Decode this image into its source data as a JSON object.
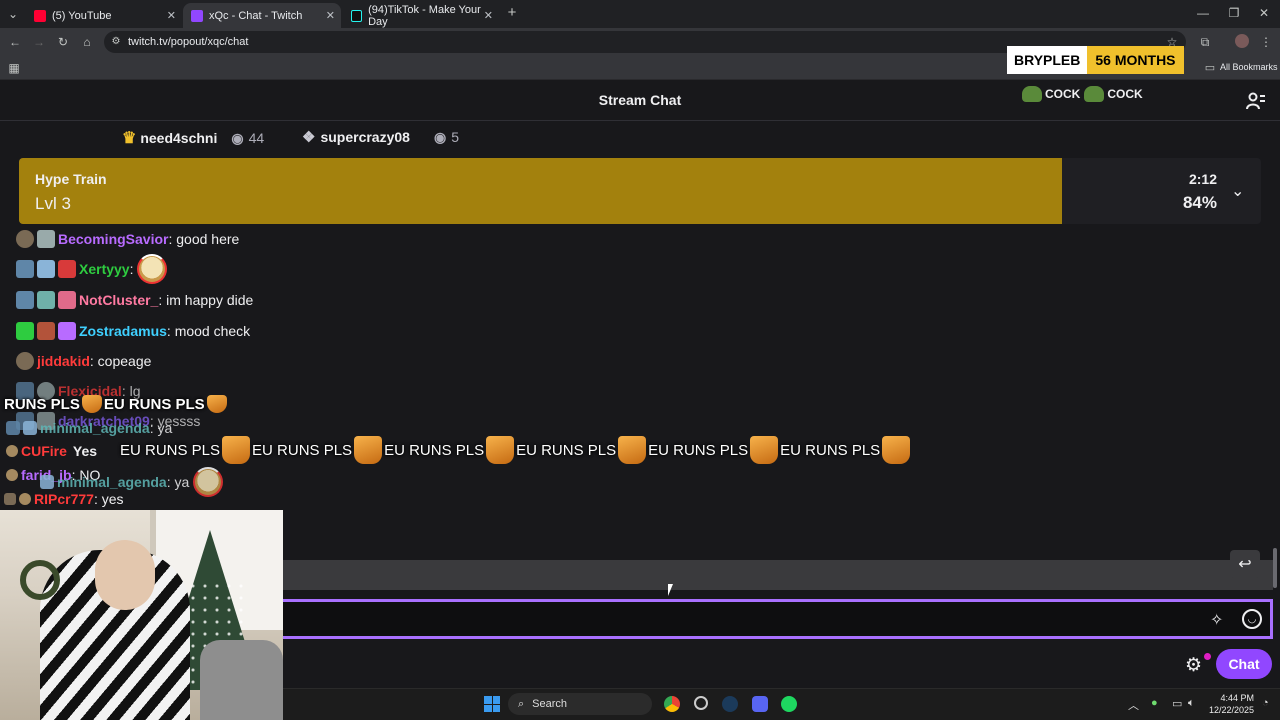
{
  "browser": {
    "tabs": [
      {
        "label": "(5) YouTube",
        "color": "#ff0033"
      },
      {
        "label": "xQc - Chat - Twitch",
        "color": "#9147ff"
      },
      {
        "label": "(94)TikTok - Make Your Day",
        "color": "#25f4ee"
      }
    ],
    "url": "twitch.tv/popout/xqc/chat",
    "bookmarks_label": "All Bookmarks"
  },
  "sub_badge": {
    "name": "BRYPLEB",
    "months": "56 MONTHS"
  },
  "header": {
    "title": "Stream Chat",
    "top_emote_text": [
      "COCK",
      "COCK"
    ]
  },
  "top_viewers": [
    {
      "name": "need4schni",
      "count": "44"
    },
    {
      "name": "supercrazy08",
      "count": "5"
    }
  ],
  "hype_train": {
    "title": "Hype Train",
    "level": "Lvl 3",
    "timer": "2:12",
    "percent_label": "84%",
    "progress": 0.84,
    "color": "#a3810d"
  },
  "messages": [
    {
      "user": "BecomingSavior",
      "color": "#b86bff",
      "text": ": good here"
    },
    {
      "user": "Xertyyy",
      "color": "#2ecc40",
      "text": ":"
    },
    {
      "user": "NotCluster_",
      "color": "#ff7aa2",
      "text": ": im happy dide"
    },
    {
      "user": "Zostradamus",
      "color": "#3fd0ff",
      "text": ": mood check"
    },
    {
      "user": "jiddakid",
      "color": "#ff3b3b",
      "text": ": copeage"
    },
    {
      "user": "Flexicidal",
      "color": "#ff3b3b",
      "text": ": lg"
    },
    {
      "user": "darkratchet09",
      "color": "#8a63ff",
      "text": ": yessss"
    },
    {
      "user": "minimal_agenda",
      "color": "#5fb7b7",
      "text": ": ya"
    },
    {
      "user": "CUFire",
      "color": "#ff3b3b",
      "text": "Yes"
    },
    {
      "user": "farid_jb",
      "color": "#b86bff",
      "text": ": NO"
    },
    {
      "user": "minimal_agenda",
      "color": "#5fb7b7",
      "text": ": ya"
    },
    {
      "user": "RIPcr777",
      "color": "#ff3b3b",
      "text": ": yes"
    }
  ],
  "overlay": {
    "line1": [
      "RUNS PLS",
      "EU RUNS PLS"
    ],
    "line2": [
      "EU RUNS PLS",
      "EU RUNS PLS",
      "EU RUNS PLS",
      "EU RUNS PLS",
      "EU RUNS PLS",
      "EU RUNS PLS"
    ]
  },
  "input": {
    "chat_button": "Chat"
  },
  "taskbar": {
    "search": "Search",
    "time": "4:44 PM",
    "date": "12/22/2025"
  }
}
